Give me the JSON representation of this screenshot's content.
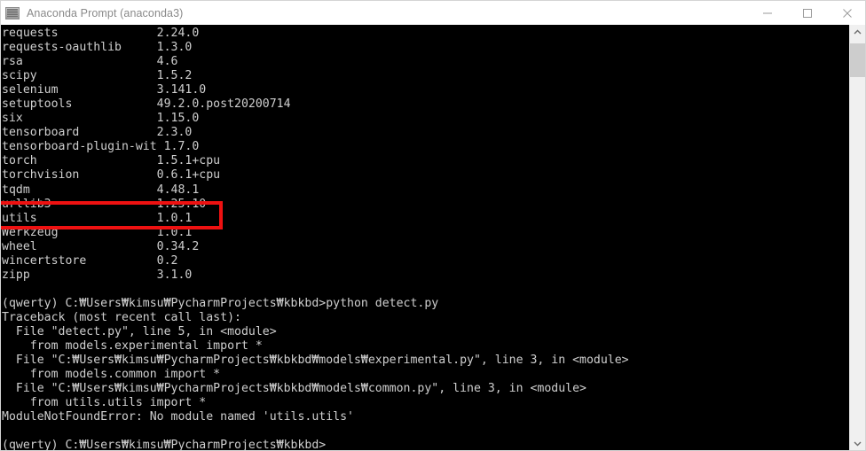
{
  "window": {
    "title": "Anaconda Prompt (anaconda3)",
    "icon": "console-window-icon",
    "controls": {
      "minimize": "minimize-icon",
      "maximize": "maximize-icon",
      "close": "close-icon"
    }
  },
  "colors": {
    "titlebar_background": "#ffffff",
    "title_text": "#8a8a8a",
    "console_background": "#000000",
    "console_text": "#cfcfcf",
    "annotation": "#ee1111",
    "scrollbar_track": "#f0f0f0",
    "scrollbar_thumb": "#cdcdcd"
  },
  "scrollbar": {
    "up_arrow": "chevron-up-icon",
    "down_arrow": "chevron-down-icon"
  },
  "annotation": {
    "shape": "rectangle",
    "color": "#ee1111",
    "highlights_row": "utils 1.0.1"
  },
  "console": {
    "package_list": [
      {
        "name": "requests",
        "version": "2.24.0"
      },
      {
        "name": "requests-oauthlib",
        "version": "1.3.0"
      },
      {
        "name": "rsa",
        "version": "4.6"
      },
      {
        "name": "scipy",
        "version": "1.5.2"
      },
      {
        "name": "selenium",
        "version": "3.141.0"
      },
      {
        "name": "setuptools",
        "version": "49.2.0.post20200714"
      },
      {
        "name": "six",
        "version": "1.15.0"
      },
      {
        "name": "tensorboard",
        "version": "2.3.0"
      },
      {
        "name": "tensorboard-plugin-wit",
        "version": "1.7.0"
      },
      {
        "name": "torch",
        "version": "1.5.1+cpu"
      },
      {
        "name": "torchvision",
        "version": "0.6.1+cpu"
      },
      {
        "name": "tqdm",
        "version": "4.48.1"
      },
      {
        "name": "urllib3",
        "version": "1.25.10"
      },
      {
        "name": "utils",
        "version": "1.0.1"
      },
      {
        "name": "Werkzeug",
        "version": "1.0.1"
      },
      {
        "name": "wheel",
        "version": "0.34.2"
      },
      {
        "name": "wincertstore",
        "version": "0.2"
      },
      {
        "name": "zipp",
        "version": "3.1.0"
      }
    ],
    "command_prompt": "(qwerty) C:₩Users₩kimsu₩PycharmProjects₩kbkbd>",
    "command": "python detect.py",
    "traceback": [
      "Traceback (most recent call last):",
      "  File \"detect.py\", line 5, in <module>",
      "    from models.experimental import *",
      "  File \"C:₩Users₩kimsu₩PycharmProjects₩kbkbd₩models₩experimental.py\", line 3, in <module>",
      "    from models.common import *",
      "  File \"C:₩Users₩kimsu₩PycharmProjects₩kbkbd₩models₩common.py\", line 3, in <module>",
      "    from utils.utils import *",
      "ModuleNotFoundError: No module named 'utils.utils'"
    ],
    "final_prompt": "(qwerty) C:₩Users₩kimsu₩PycharmProjects₩kbkbd>"
  }
}
